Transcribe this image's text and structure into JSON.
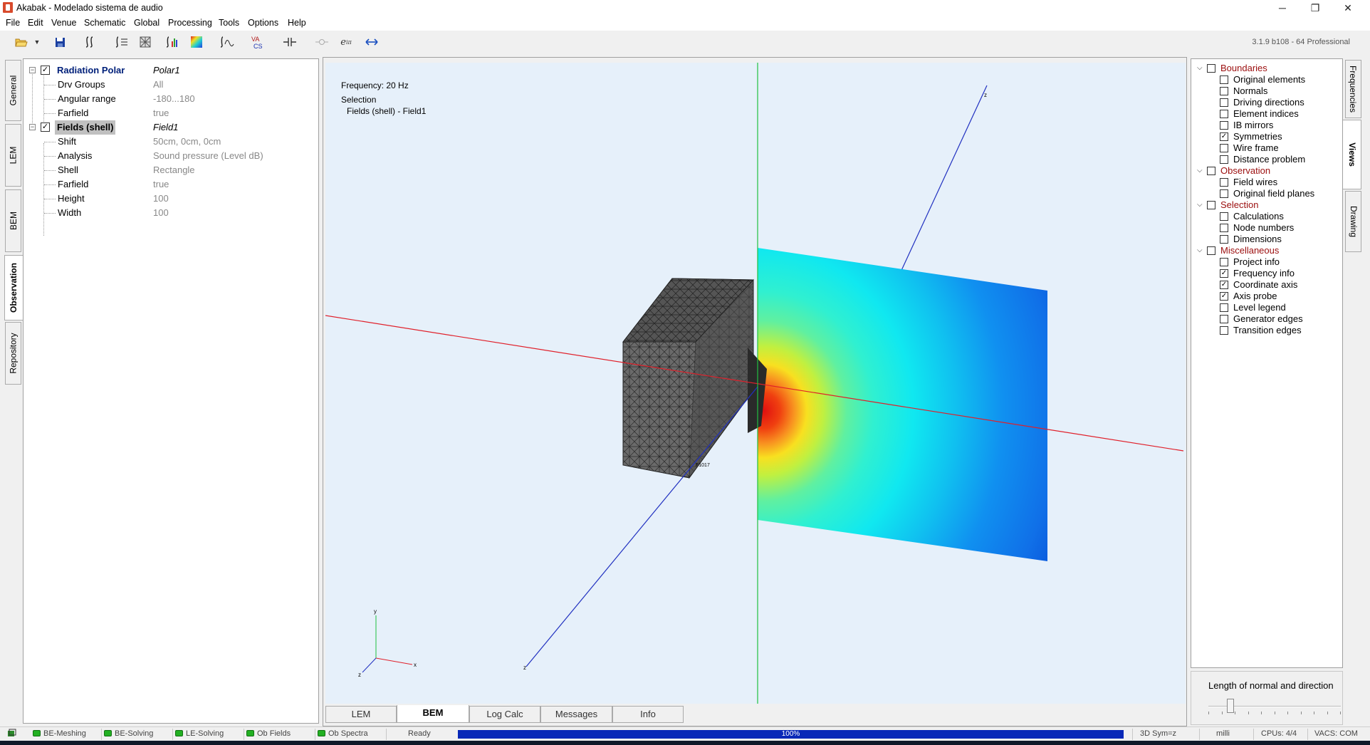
{
  "window": {
    "title": "Akabak - Modelado sistema de audio",
    "minimize": "─",
    "restore": "❐",
    "close": "✕"
  },
  "menu": [
    "File",
    "Edit",
    "Venue",
    "Schematic",
    "Global",
    "Processing",
    "Tools",
    "Options",
    "Help"
  ],
  "toolbar": {
    "version": "3.1.9 b108 - 64 Professional"
  },
  "left_tabs": [
    {
      "label": "General",
      "active": false
    },
    {
      "label": "LEM",
      "active": false
    },
    {
      "label": "BEM",
      "active": false
    },
    {
      "label": "Observation",
      "active": true
    },
    {
      "label": "Repository",
      "active": false
    }
  ],
  "properties": {
    "radiation": {
      "header": "Radiation Polar",
      "value": "Polar1",
      "checked": true,
      "rows": [
        {
          "name": "Drv Groups",
          "value": "All"
        },
        {
          "name": "Angular range",
          "value": "-180...180"
        },
        {
          "name": "Farfield",
          "value": "true"
        }
      ]
    },
    "fields": {
      "header": "Fields (shell)",
      "value": "Field1",
      "checked": true,
      "rows": [
        {
          "name": "Shift",
          "value": "50cm, 0cm, 0cm"
        },
        {
          "name": "Analysis",
          "value": "Sound pressure (Level dB)"
        },
        {
          "name": "Shell",
          "value": "Rectangle"
        },
        {
          "name": "Farfield",
          "value": "true"
        },
        {
          "name": "Height",
          "value": "100"
        },
        {
          "name": "Width",
          "value": "100"
        }
      ]
    }
  },
  "viewport": {
    "frequency": "Frequency: 20 Hz",
    "selection_label": "Selection",
    "selection_item": "Fields (shell) - Field1",
    "axis_labels": {
      "x": "x",
      "y": "y",
      "z": "z"
    },
    "node_labels": [
      "F1017"
    ]
  },
  "bottom_tabs": [
    {
      "label": "LEM",
      "active": false
    },
    {
      "label": "BEM",
      "active": true
    },
    {
      "label": "Log Calc",
      "active": false
    },
    {
      "label": "Messages",
      "active": false
    },
    {
      "label": "Info",
      "active": false
    }
  ],
  "views_panel": {
    "groups": [
      {
        "label": "Boundaries",
        "checked": false,
        "items": [
          {
            "label": "Original elements",
            "checked": false
          },
          {
            "label": "Normals",
            "checked": false
          },
          {
            "label": "Driving directions",
            "checked": false
          },
          {
            "label": "Element indices",
            "checked": false
          },
          {
            "label": "IB mirrors",
            "checked": false
          },
          {
            "label": "Symmetries",
            "checked": true
          },
          {
            "label": "Wire frame",
            "checked": false
          },
          {
            "label": "Distance problem",
            "checked": false
          }
        ]
      },
      {
        "label": "Observation",
        "checked": false,
        "items": [
          {
            "label": "Field wires",
            "checked": false
          },
          {
            "label": "Original field planes",
            "checked": false
          }
        ]
      },
      {
        "label": "Selection",
        "checked": false,
        "items": [
          {
            "label": "Calculations",
            "checked": false
          },
          {
            "label": "Node numbers",
            "checked": false
          },
          {
            "label": "Dimensions",
            "checked": false
          }
        ]
      },
      {
        "label": "Miscellaneous",
        "checked": false,
        "items": [
          {
            "label": "Project info",
            "checked": false
          },
          {
            "label": "Frequency info",
            "checked": true
          },
          {
            "label": "Coordinate axis",
            "checked": true
          },
          {
            "label": "Axis probe",
            "checked": true
          },
          {
            "label": "Level legend",
            "checked": false
          },
          {
            "label": "Generator edges",
            "checked": false
          },
          {
            "label": "Transition edges",
            "checked": false
          }
        ]
      }
    ],
    "slider_label": "Length of normal and direction",
    "slider_value": 0.15
  },
  "right_tabs": [
    {
      "label": "Frequencies",
      "active": false
    },
    {
      "label": "Views",
      "active": true
    },
    {
      "label": "Drawing",
      "active": false
    }
  ],
  "status": {
    "items": [
      "BE-Meshing",
      "BE-Solving",
      "LE-Solving",
      "Ob Fields",
      "Ob Spectra"
    ],
    "ready": "Ready",
    "progress": "100%",
    "progress_value": 1.0,
    "mode": "3D Sym=z",
    "unit": "milli",
    "cpus": "CPUs: 4/4",
    "vacs": "VACS: COM"
  },
  "colors": {
    "x_axis": "#e0202a",
    "z_axis": "#2030c0",
    "y_axis": "#20c040",
    "progress": "#0828b8",
    "group_text": "#9b0d0d"
  }
}
